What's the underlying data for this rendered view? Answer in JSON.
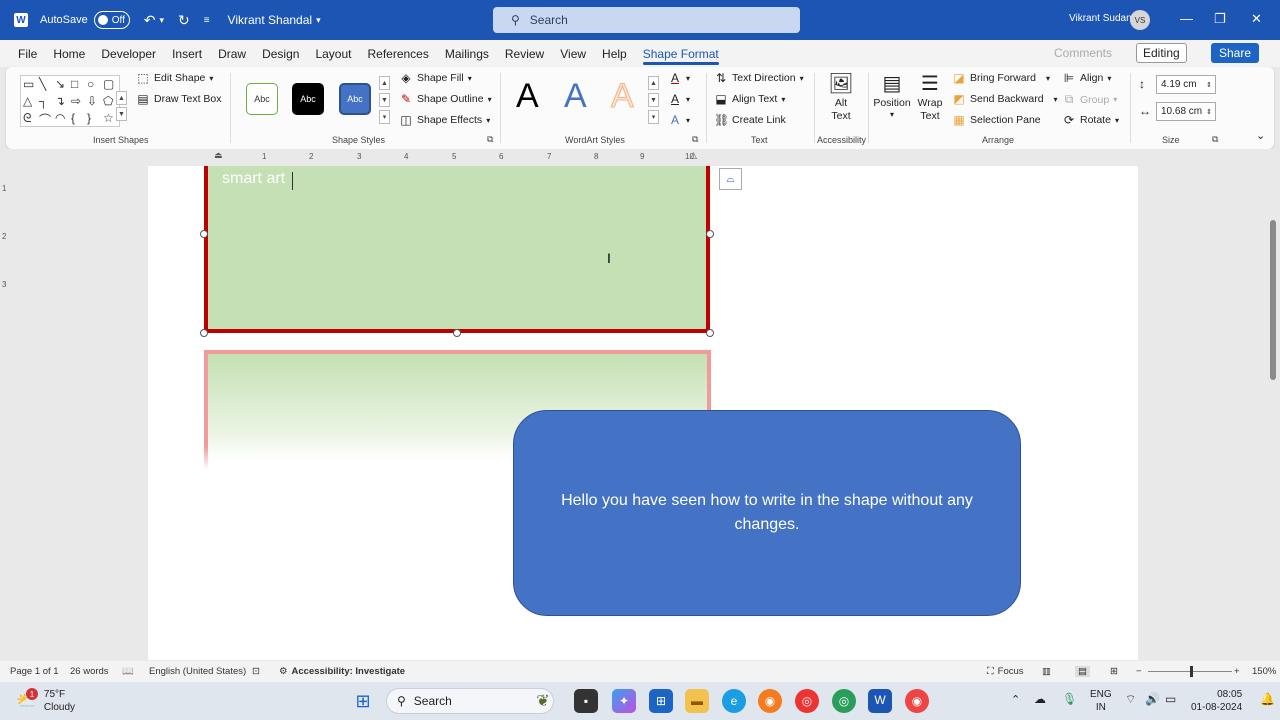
{
  "titlebar": {
    "autosave_label": "AutoSave",
    "autosave_state": "Off",
    "doc_name": "Vikrant Shandal",
    "search_placeholder": "Search",
    "user_name": "Vikrant Sudan",
    "user_initials": "VS"
  },
  "tabs": [
    {
      "label": "File"
    },
    {
      "label": "Home"
    },
    {
      "label": "Developer"
    },
    {
      "label": "Insert"
    },
    {
      "label": "Draw"
    },
    {
      "label": "Design"
    },
    {
      "label": "Layout"
    },
    {
      "label": "References"
    },
    {
      "label": "Mailings"
    },
    {
      "label": "Review"
    },
    {
      "label": "View"
    },
    {
      "label": "Help"
    },
    {
      "label": "Shape Format"
    }
  ],
  "tab_right": {
    "comments": "Comments",
    "editing": "Editing",
    "share": "Share"
  },
  "ribbon": {
    "insert_shapes": {
      "label": "Insert Shapes",
      "edit_shape": "Edit Shape",
      "draw_text_box": "Draw Text Box"
    },
    "shape_styles": {
      "label": "Shape Styles",
      "sample": "Abc",
      "shape_fill": "Shape Fill",
      "shape_outline": "Shape Outline",
      "shape_effects": "Shape Effects"
    },
    "wordart": {
      "label": "WordArt Styles",
      "letter": "A"
    },
    "text": {
      "label": "Text",
      "text_direction": "Text Direction",
      "align_text": "Align Text",
      "create_link": "Create Link"
    },
    "accessibility": {
      "label": "Accessibility",
      "alt_text_1": "Alt",
      "alt_text_2": "Text"
    },
    "arrange": {
      "label": "Arrange",
      "position": "Position",
      "wrap_1": "Wrap",
      "wrap_2": "Text",
      "bring_forward": "Bring Forward",
      "send_backward": "Send Backward",
      "selection_pane": "Selection Pane",
      "align": "Align",
      "group": "Group",
      "rotate": "Rotate"
    },
    "size": {
      "label": "Size",
      "height": "4.19 cm",
      "width": "10.68 cm"
    }
  },
  "ruler": {
    "h": [
      "1",
      "2",
      "3",
      "4",
      "5",
      "6",
      "7",
      "8",
      "9",
      "10"
    ],
    "v": [
      "1",
      "2",
      "3"
    ]
  },
  "document": {
    "shape1_text": "smart art",
    "shape3_text": "Hello you have seen how to write in the shape without any changes."
  },
  "statusbar": {
    "page": "Page 1 of 1",
    "words": "26 words",
    "language": "English (United States)",
    "accessibility": "Accessibility: Investigate",
    "focus": "Focus",
    "zoom": "150%"
  },
  "taskbar": {
    "weather_temp": "75°F",
    "weather_desc": "Cloudy",
    "weather_badge": "1",
    "search": "Search",
    "lang_1": "ENG",
    "lang_2": "IN",
    "time": "08:05",
    "date": "01-08-2024"
  },
  "colors": {
    "accent": "#1d55b4",
    "shape_fill_green": "#c5e0b4",
    "shape_outline_red": "#c00000",
    "shape_blue": "#4472c4"
  }
}
